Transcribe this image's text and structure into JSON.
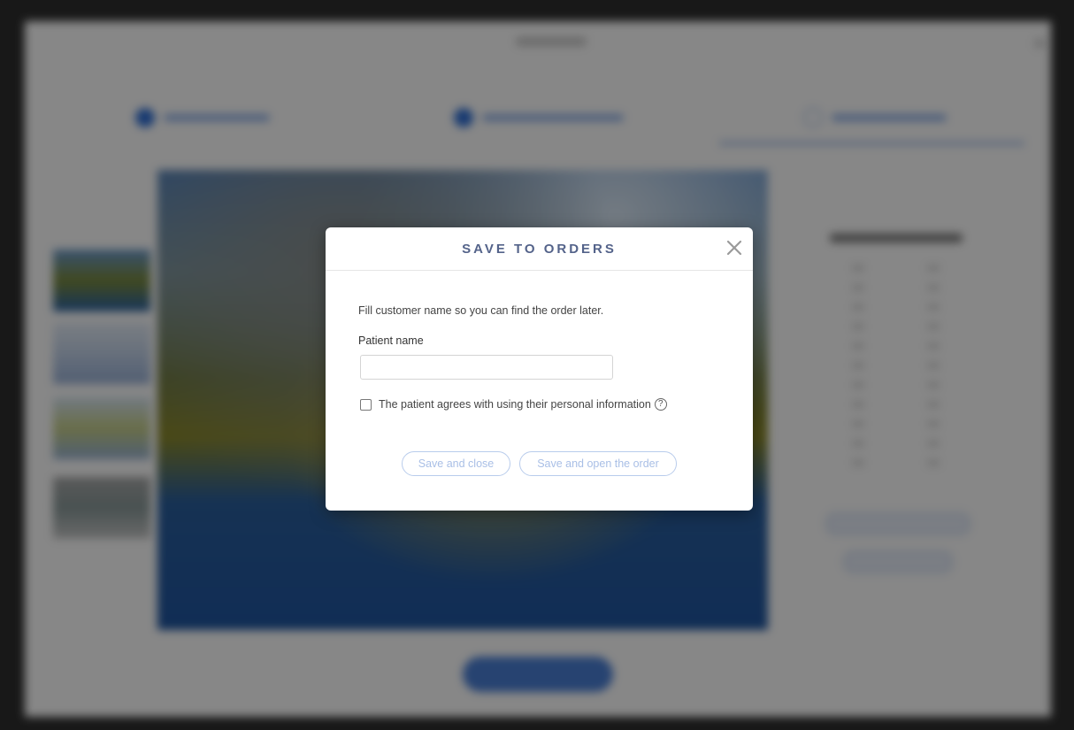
{
  "modal": {
    "title": "SAVE TO ORDERS",
    "intro": "Fill customer name so you can find the order later.",
    "patient_label": "Patient name",
    "patient_value": "",
    "consent_label": "The patient agrees with using their personal information",
    "consent_checked": false,
    "help_glyph": "?",
    "buttons": {
      "save_close": "Save and close",
      "save_open": "Save and open the order"
    }
  },
  "icons": {
    "close": "close-icon",
    "help": "question-circle-icon"
  },
  "colors": {
    "title": "#54638a",
    "button_border": "#b9ccec",
    "button_text": "#a9bfe6",
    "overlay": "rgba(0,0,0,0.47)"
  }
}
